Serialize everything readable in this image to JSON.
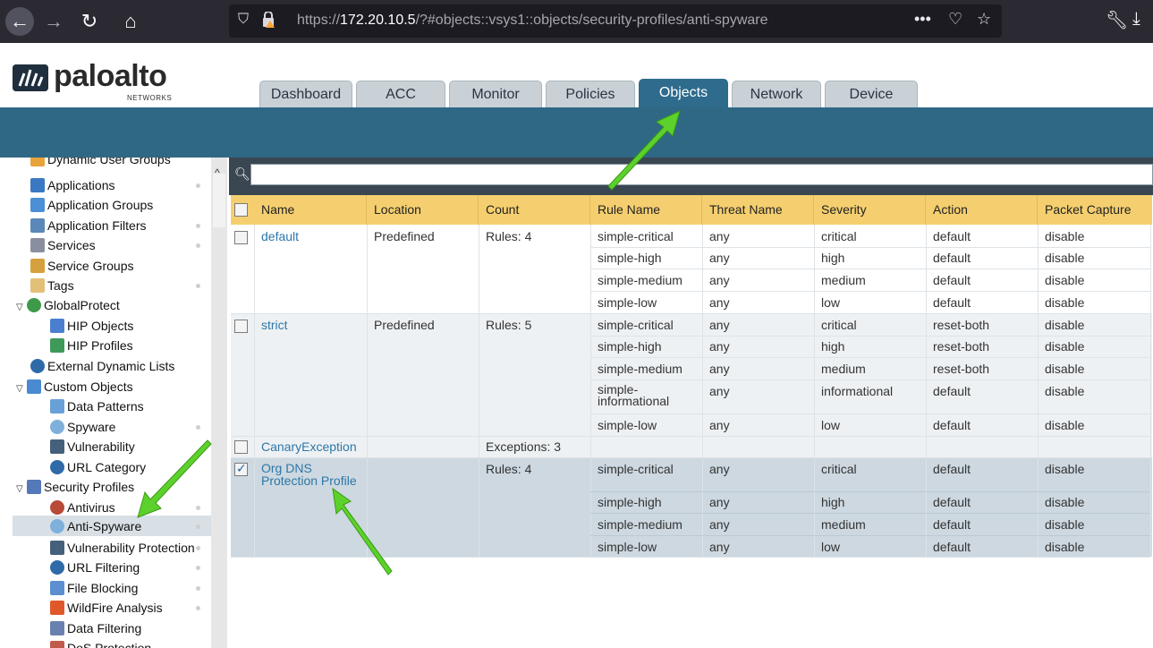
{
  "browser": {
    "url_prefix": "https://",
    "url_host": "172.20.10.5",
    "url_path": "/?#objects::vsys1::objects/security-profiles/anti-spyware",
    "more": "•••"
  },
  "app": {
    "logo_word": "paloalto",
    "logo_sub": "NETWORKS",
    "tabs": [
      "Dashboard",
      "ACC",
      "Monitor",
      "Policies",
      "Objects",
      "Network",
      "Device"
    ],
    "active_tab": "Objects"
  },
  "sidebar": {
    "items": [
      {
        "label": "Dynamic User Groups",
        "indent": 1
      },
      {
        "label": "Applications",
        "indent": 1
      },
      {
        "label": "Application Groups",
        "indent": 1
      },
      {
        "label": "Application Filters",
        "indent": 1
      },
      {
        "label": "Services",
        "indent": 1
      },
      {
        "label": "Service Groups",
        "indent": 1
      },
      {
        "label": "Tags",
        "indent": 1
      },
      {
        "label": "GlobalProtect",
        "indent": 0
      },
      {
        "label": "HIP Objects",
        "indent": 2
      },
      {
        "label": "HIP Profiles",
        "indent": 2
      },
      {
        "label": "External Dynamic Lists",
        "indent": 1
      },
      {
        "label": "Custom Objects",
        "indent": 0
      },
      {
        "label": "Data Patterns",
        "indent": 2
      },
      {
        "label": "Spyware",
        "indent": 2
      },
      {
        "label": "Vulnerability",
        "indent": 2
      },
      {
        "label": "URL Category",
        "indent": 2
      },
      {
        "label": "Security Profiles",
        "indent": 0
      },
      {
        "label": "Antivirus",
        "indent": 2
      },
      {
        "label": "Anti-Spyware",
        "indent": 2
      },
      {
        "label": "Vulnerability Protection",
        "indent": 2
      },
      {
        "label": "URL Filtering",
        "indent": 2
      },
      {
        "label": "File Blocking",
        "indent": 2
      },
      {
        "label": "WildFire Analysis",
        "indent": 2
      },
      {
        "label": "Data Filtering",
        "indent": 2
      },
      {
        "label": "DoS Protection",
        "indent": 2
      }
    ]
  },
  "table": {
    "headers": [
      "Name",
      "Location",
      "Count",
      "Rule Name",
      "Threat Name",
      "Severity",
      "Action",
      "Packet Capture"
    ],
    "profiles": [
      {
        "name": "default",
        "location": "Predefined",
        "count": "Rules: 4",
        "checked": false,
        "rules": [
          [
            "simple-critical",
            "any",
            "critical",
            "default",
            "disable"
          ],
          [
            "simple-high",
            "any",
            "high",
            "default",
            "disable"
          ],
          [
            "simple-medium",
            "any",
            "medium",
            "default",
            "disable"
          ],
          [
            "simple-low",
            "any",
            "low",
            "default",
            "disable"
          ]
        ]
      },
      {
        "name": "strict",
        "location": "Predefined",
        "count": "Rules: 5",
        "checked": false,
        "rules": [
          [
            "simple-critical",
            "any",
            "critical",
            "reset-both",
            "disable"
          ],
          [
            "simple-high",
            "any",
            "high",
            "reset-both",
            "disable"
          ],
          [
            "simple-medium",
            "any",
            "medium",
            "reset-both",
            "disable"
          ],
          [
            "simple-informational",
            "any",
            "informational",
            "default",
            "disable"
          ],
          [
            "simple-low",
            "any",
            "low",
            "default",
            "disable"
          ]
        ]
      },
      {
        "name": "CanaryException",
        "location": "",
        "count": "Exceptions: 3",
        "checked": false,
        "rules": []
      },
      {
        "name": "Org DNS Protection Profile",
        "location": "",
        "count": "Rules: 4",
        "checked": true,
        "rules": [
          [
            "simple-critical",
            "any",
            "critical",
            "default",
            "disable"
          ],
          [
            "simple-high",
            "any",
            "high",
            "default",
            "disable"
          ],
          [
            "simple-medium",
            "any",
            "medium",
            "default",
            "disable"
          ],
          [
            "simple-low",
            "any",
            "low",
            "default",
            "disable"
          ]
        ]
      }
    ]
  },
  "colors": {
    "header_band": "#2f6885",
    "table_header": "#f5cf6f",
    "link": "#2d77a8",
    "selected_row": "#cdd8e0",
    "arrow": "#5cd12c"
  }
}
